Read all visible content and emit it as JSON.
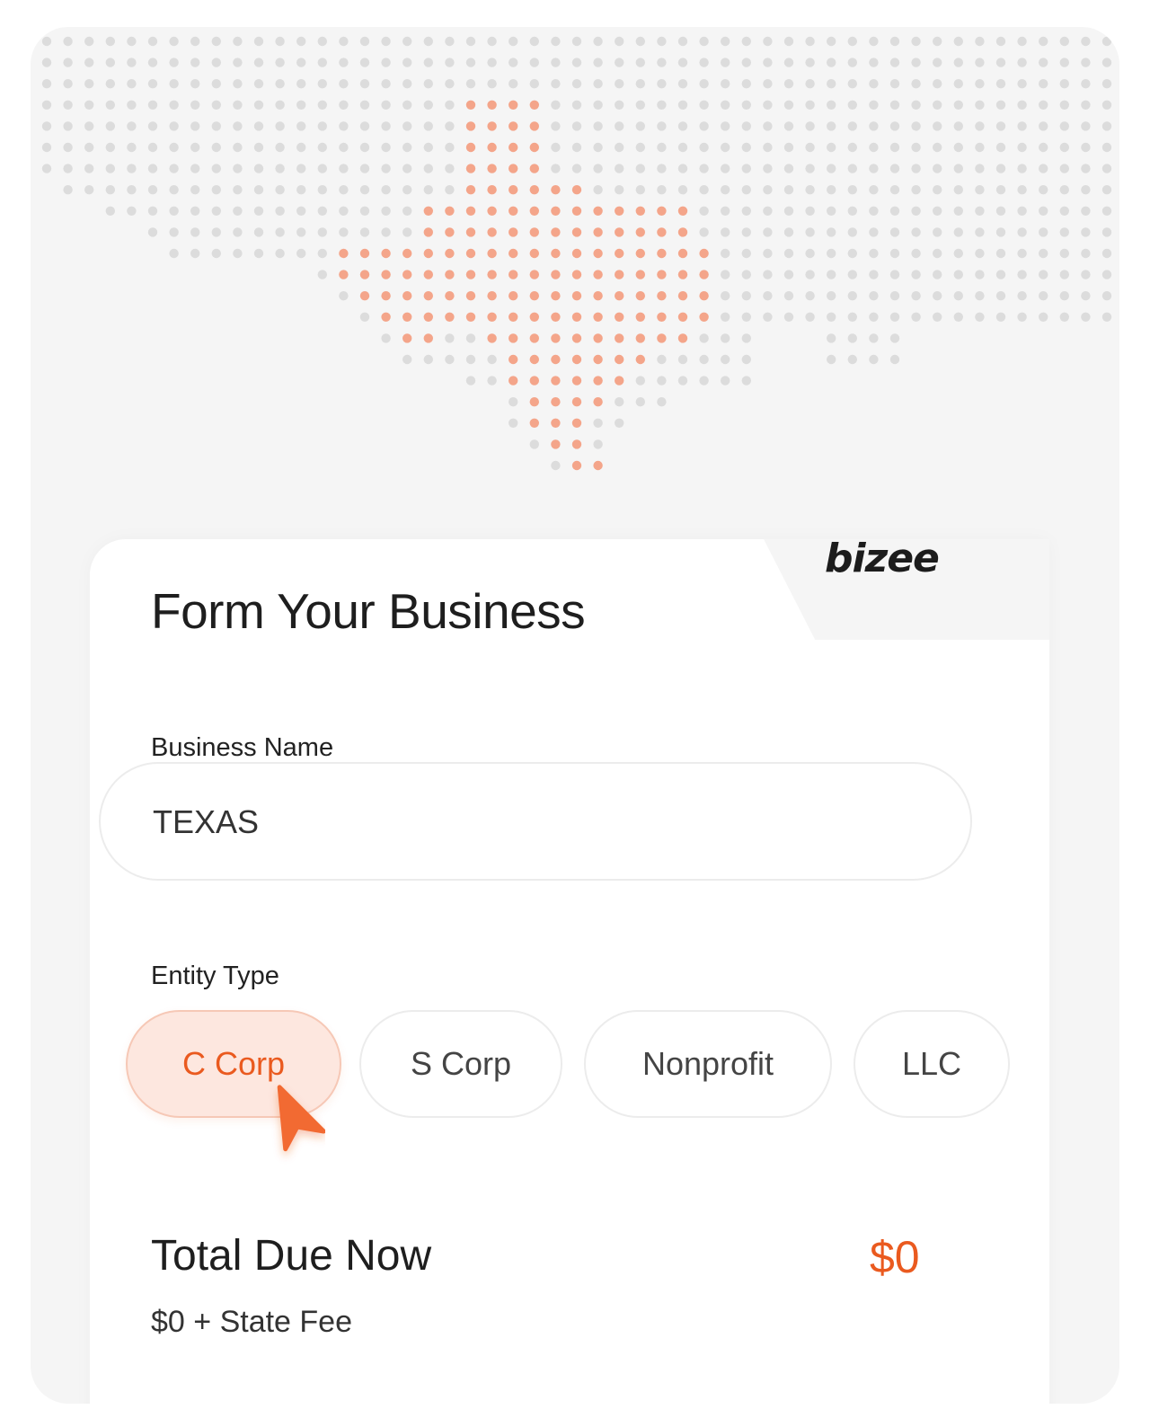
{
  "brand": {
    "logo_text": "bizee",
    "accent_color": "#ea5a1f"
  },
  "map": {
    "highlighted_state": "Texas"
  },
  "form": {
    "title": "Form Your Business",
    "business_name_label": "Business Name",
    "business_name_value": "TEXAS",
    "entity_type_label": "Entity Type",
    "entity_types": [
      {
        "label": "C Corp",
        "selected": true
      },
      {
        "label": "S Corp",
        "selected": false
      },
      {
        "label": "Nonprofit",
        "selected": false
      },
      {
        "label": "LLC",
        "selected": false
      }
    ]
  },
  "total": {
    "label": "Total Due Now",
    "value": "$0",
    "sub": "$0 + State Fee"
  }
}
